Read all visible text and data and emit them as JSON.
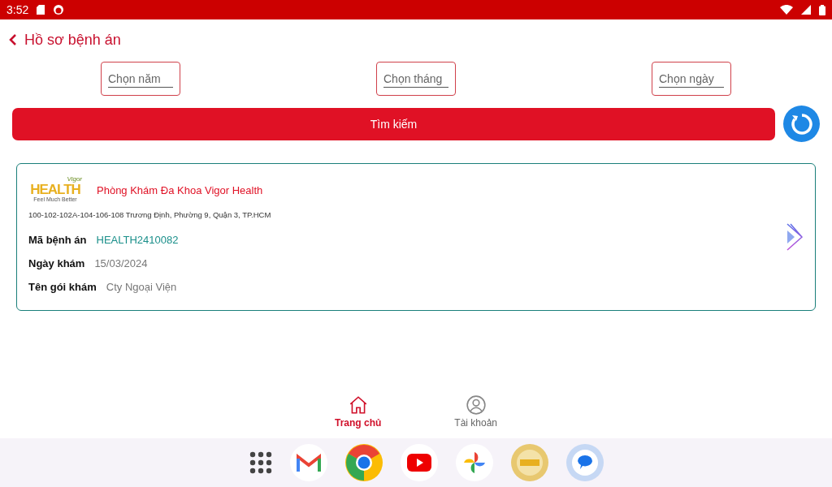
{
  "status_bar": {
    "time": "3:52"
  },
  "header": {
    "title": "Hồ sơ bệnh án"
  },
  "filters": [
    {
      "placeholder": "Chọn năm"
    },
    {
      "placeholder": "Chọn tháng"
    },
    {
      "placeholder": "Chọn ngày"
    }
  ],
  "search_button": {
    "label": "Tìm kiếm"
  },
  "records": [
    {
      "logo": {
        "top": "Vigor",
        "main": "HEALTH",
        "tagline": "Feel Much Better"
      },
      "clinic": "Phòng Khám Đa Khoa Vigor Health",
      "address": "100-102-102A-104-106-108 Trương Định, Phường 9, Quận 3, TP.HCM",
      "fields": [
        {
          "label": "Mã bệnh án",
          "value": "HEALTH2410082",
          "kind": "code"
        },
        {
          "label": "Ngày khám",
          "value": "15/03/2024",
          "kind": "plain"
        },
        {
          "label": "Tên gói khám",
          "value": "Cty Ngoại Viện",
          "kind": "plain"
        }
      ]
    }
  ],
  "bottom_nav": [
    {
      "label": "Trang chủ",
      "kind": "home",
      "selected": true
    },
    {
      "label": "Tài khoản",
      "kind": "account",
      "selected": false
    }
  ]
}
